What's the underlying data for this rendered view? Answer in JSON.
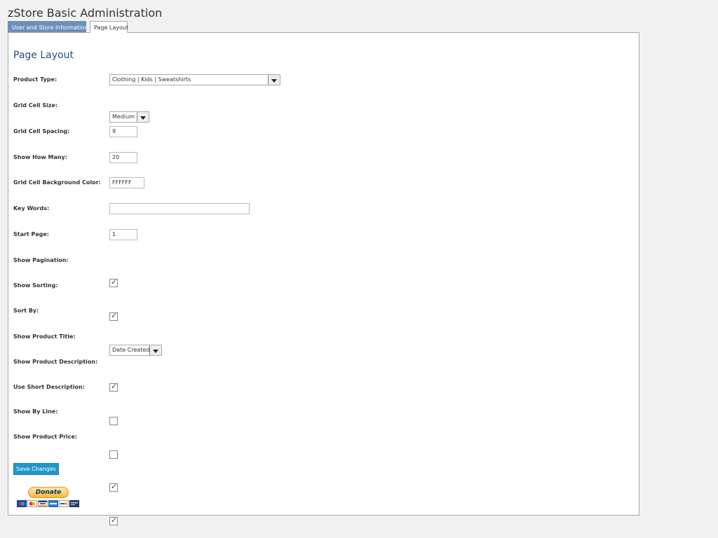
{
  "header": {
    "title": "zStore Basic Administration"
  },
  "tabs": [
    {
      "label": "User and Store Information",
      "active": false
    },
    {
      "label": "Page Layout",
      "active": true
    }
  ],
  "panel": {
    "heading": "Page Layout"
  },
  "fields": {
    "product_type": {
      "label": "Product Type:",
      "value": "Clothing | Kids | Sweatshirts"
    },
    "grid_cell_size": {
      "label": "Grid Cell Size:",
      "value": "Medium"
    },
    "grid_cell_spacing": {
      "label": "Grid Cell Spacing:",
      "value": "9"
    },
    "show_how_many": {
      "label": "Show How Many:",
      "value": "20"
    },
    "grid_cell_bg": {
      "label": "Grid Cell Background Color:",
      "value": "FFFFFF"
    },
    "key_words": {
      "label": "Key Words:",
      "value": ""
    },
    "start_page": {
      "label": "Start Page:",
      "value": "1"
    },
    "show_pagination": {
      "label": "Show Pagination:",
      "checked": true
    },
    "show_sorting": {
      "label": "Show Sorting:",
      "checked": true
    },
    "sort_by": {
      "label": "Sort By:",
      "value": "Date Created"
    },
    "show_product_title": {
      "label": "Show Product Title:",
      "checked": true
    },
    "show_product_description": {
      "label": "Show Product Description:",
      "checked": false
    },
    "use_short_description": {
      "label": "Use Short Description:",
      "checked": false
    },
    "show_by_line": {
      "label": "Show By Line:",
      "checked": true
    },
    "show_product_price": {
      "label": "Show Product Price:",
      "checked": true
    }
  },
  "check_glyph": "✓",
  "actions": {
    "save_label": "Save Changes",
    "donate_label": "Donate"
  },
  "card_icons": [
    "maestro-card-icon",
    "mastercard-icon",
    "visa-icon",
    "amex-icon",
    "discover-icon",
    "bank-card-icon"
  ]
}
